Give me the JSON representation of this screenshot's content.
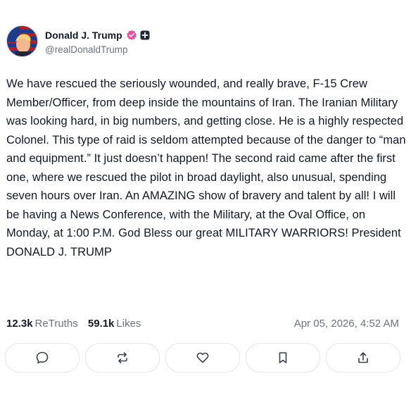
{
  "author": {
    "display_name": "Donald J. Trump",
    "handle": "@realDonaldTrump",
    "verified_icon": "verified-check-icon",
    "plus_icon": "plus-badge-icon"
  },
  "post": {
    "text": "We have rescued the seriously wounded, and really brave, F-15 Crew Member/Officer, from deep inside the mountains of Iran. The Iranian Military was looking hard, in big numbers, and getting close. He is a highly respected Colonel. This type of raid is seldom attempted because of the danger to “man and equipment.” It just doesn’t happen! The second raid came after the first one, where we rescued the pilot in broad daylight, also unusual, spending seven hours over Iran. An AMAZING show of bravery and talent by all! I will be having a News Conference, with the Military, at the Oval Office, on Monday, at 1:00 P.M. God Bless our great MILITARY WARRIORS! President DONALD J. TRUMP",
    "retruths_count": "12.3k",
    "retruths_label": "ReTruths",
    "likes_count": "59.1k",
    "likes_label": "Likes",
    "timestamp": "Apr 05, 2026, 4:52 AM"
  },
  "actions": [
    {
      "name": "reply",
      "icon": "reply-bubble-icon"
    },
    {
      "name": "retruth",
      "icon": "repost-icon"
    },
    {
      "name": "like",
      "icon": "heart-icon"
    },
    {
      "name": "bookmark",
      "icon": "bookmark-icon"
    },
    {
      "name": "share",
      "icon": "share-icon"
    }
  ],
  "colors": {
    "text": "#111827",
    "muted": "#6b7280",
    "verified": "#e94e9b",
    "border": "#e5e7eb"
  }
}
